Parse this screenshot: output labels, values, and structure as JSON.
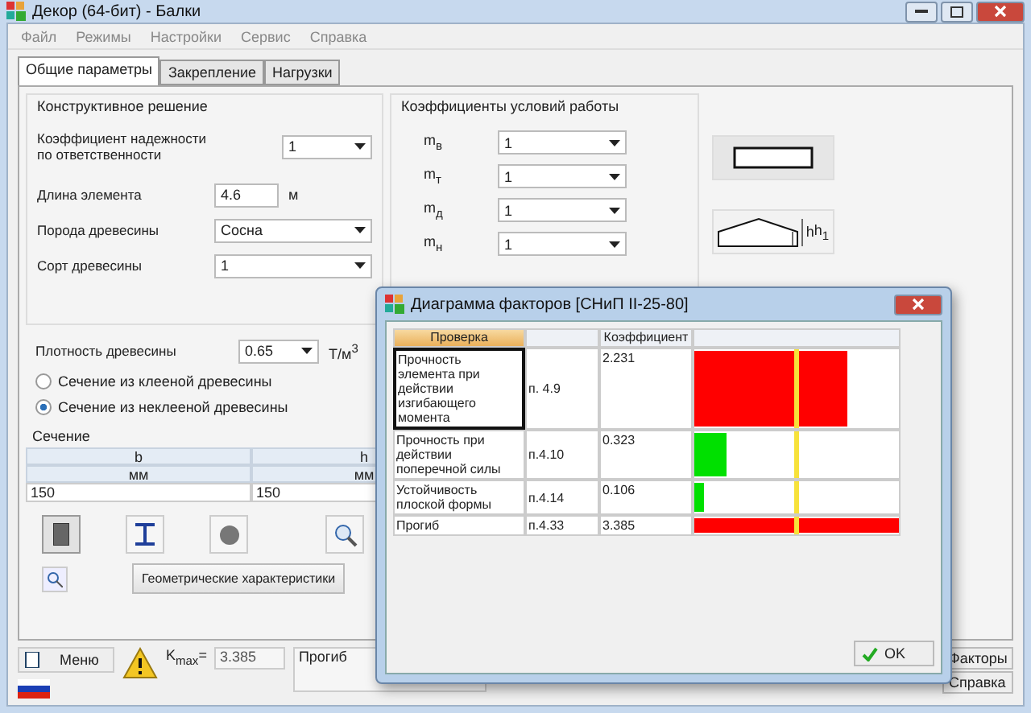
{
  "window": {
    "title": "Декор (64-бит) - Балки"
  },
  "menu": [
    "Файл",
    "Режимы",
    "Настройки",
    "Сервис",
    "Справка"
  ],
  "tabs": [
    {
      "label": "Общие параметры",
      "selected": true
    },
    {
      "label": "Закрепление",
      "selected": false
    },
    {
      "label": "Нагрузки",
      "selected": false
    }
  ],
  "design": {
    "title": "Конструктивное решение",
    "fields": [
      {
        "kind": "select",
        "label": "Коэффициент надежности по ответственности",
        "value": "1"
      },
      {
        "kind": "input",
        "label": "Длина элемента",
        "value": "4.6",
        "unit": "м"
      },
      {
        "kind": "select",
        "label": "Порода древесины",
        "value": "Сосна"
      },
      {
        "kind": "select",
        "label": "Сорт древесины",
        "value": "1"
      }
    ]
  },
  "density": {
    "label": "Плотность древесины",
    "value": "0.65",
    "unit": "Т/м$^{3}$"
  },
  "radios": [
    {
      "label": "Сечение из клееной древесины",
      "selected": false
    },
    {
      "label": "Сечение из неклееной древесины",
      "selected": true
    }
  ],
  "coefficients": {
    "title": "Коэффициенты условий работы",
    "rows": [
      {
        "label": "m$_{в}$",
        "value": "1"
      },
      {
        "label": "m$_{т}$",
        "value": "1"
      },
      {
        "label": "m$_{д}$",
        "value": "1"
      },
      {
        "label": "m$_{н}$",
        "value": "1"
      }
    ]
  },
  "pictograms": [
    {
      "kind": "rectangle",
      "selected": true
    },
    {
      "kind": "gable",
      "selected": false,
      "labels": [
        "h",
        "h$_{1}$"
      ]
    }
  ],
  "section": {
    "title": "Сечение",
    "columns": [
      {
        "name": "b",
        "unit": "мм",
        "value": "150"
      },
      {
        "name": "h",
        "unit": "мм",
        "value": "150"
      }
    ]
  },
  "shapes": [
    {
      "kind": "rect",
      "selected": true
    },
    {
      "kind": "ibeam",
      "selected": false
    },
    {
      "kind": "circle",
      "selected": false
    }
  ],
  "geometry_button": "Геометрические характеристики",
  "status": {
    "menu": "Меню",
    "kmax_label": "K$_{max}$=",
    "kmax": "3.385",
    "result": "Прогиб",
    "buttons": [
      "Факторы",
      "Справка"
    ]
  },
  "dialog": {
    "title": "Диаграмма факторов [СНиП II-25-80]",
    "columns": [
      "Проверка",
      "Коэффициент"
    ],
    "rows": [
      {
        "check": "Прочность элемента при действии изгибающего момента",
        "clause": "п. 4.9",
        "coefficient": "2.231",
        "level": 0.75,
        "color": "#ff0000",
        "selected": true
      },
      {
        "check": "Прочность при действии поперечной силы",
        "clause": "п.4.10",
        "coefficient": "0.323",
        "level": 0.16,
        "color": "#00e000",
        "selected": false
      },
      {
        "check": "Устойчивость плоской формы",
        "clause": "п.4.14",
        "coefficient": "0.106",
        "level": 0.05,
        "color": "#00e000",
        "selected": false
      },
      {
        "check": "Прогиб",
        "clause": "п.4.33",
        "coefficient": "3.385",
        "level": 1,
        "color": "#ff0000",
        "selected": false
      }
    ],
    "ok": "OK"
  }
}
